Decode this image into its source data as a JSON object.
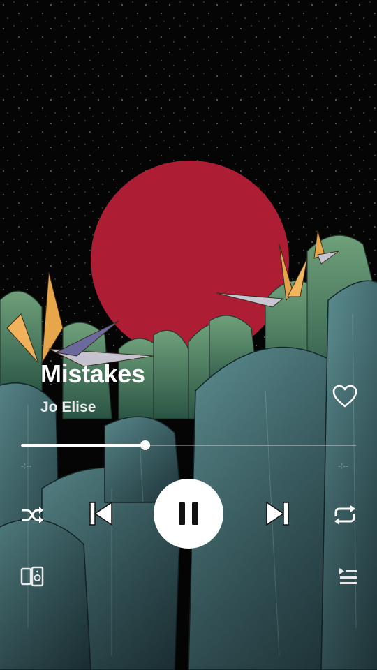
{
  "track": {
    "title": "Mistakes",
    "artist": "Jo Elise"
  },
  "playback": {
    "progress": 0.37,
    "elapsed": "-:--",
    "remaining": "-:--",
    "state": "playing"
  },
  "icons": {
    "like": "heart-icon",
    "shuffle": "shuffle-icon",
    "previous": "skip-previous-icon",
    "play_pause": "pause-icon",
    "next": "skip-next-icon",
    "repeat": "repeat-icon",
    "devices": "devices-icon",
    "queue": "queue-icon"
  },
  "colors": {
    "sky": "#050505",
    "sun": "#b01f35",
    "leaf": "#3f7767",
    "accent": "#ffffff"
  }
}
